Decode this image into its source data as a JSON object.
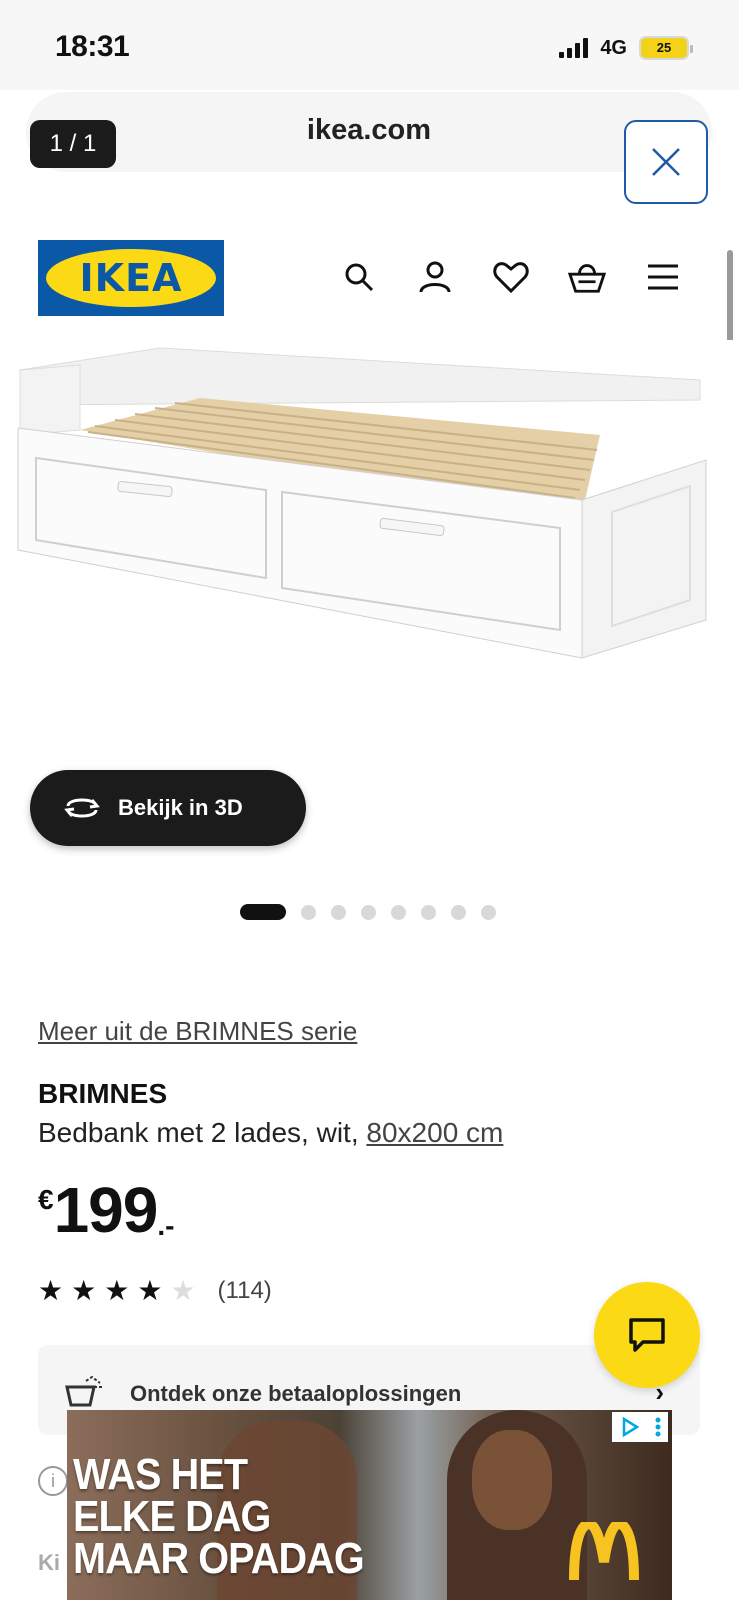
{
  "status_bar": {
    "time": "18:31",
    "network": "4G",
    "battery": "25"
  },
  "browser": {
    "url": "ikea.com",
    "tab_count": "1 / 1"
  },
  "header": {
    "logo_text": "IKEA",
    "icons": [
      "search-icon",
      "account-icon",
      "heart-icon",
      "basket-icon",
      "menu-icon"
    ]
  },
  "gallery": {
    "view_3d_label": "Bekijk in 3D",
    "total_images": 8,
    "active_index": 0
  },
  "product": {
    "series_link": "Meer uit de BRIMNES serie",
    "name": "BRIMNES",
    "description": "Bedbank met 2 lades, wit, ",
    "size_link": "80x200 cm",
    "price_currency": "€",
    "price_amount": "199",
    "price_suffix": ".-",
    "rating": 4,
    "rating_max": 5,
    "review_count": "(114)"
  },
  "payment_banner": {
    "label": "Ontdek onze betaaloplossingen"
  },
  "partial_text": {
    "below": "Ki"
  },
  "ad": {
    "headline_1": "WAS HET",
    "headline_2": "ELKE DAG",
    "headline_3": "MAAR OPADAG",
    "brand": "McDonald's"
  },
  "colors": {
    "ikea_blue": "#0a58a6",
    "ikea_yellow": "#fbd914",
    "dark": "#1b1b1b"
  }
}
